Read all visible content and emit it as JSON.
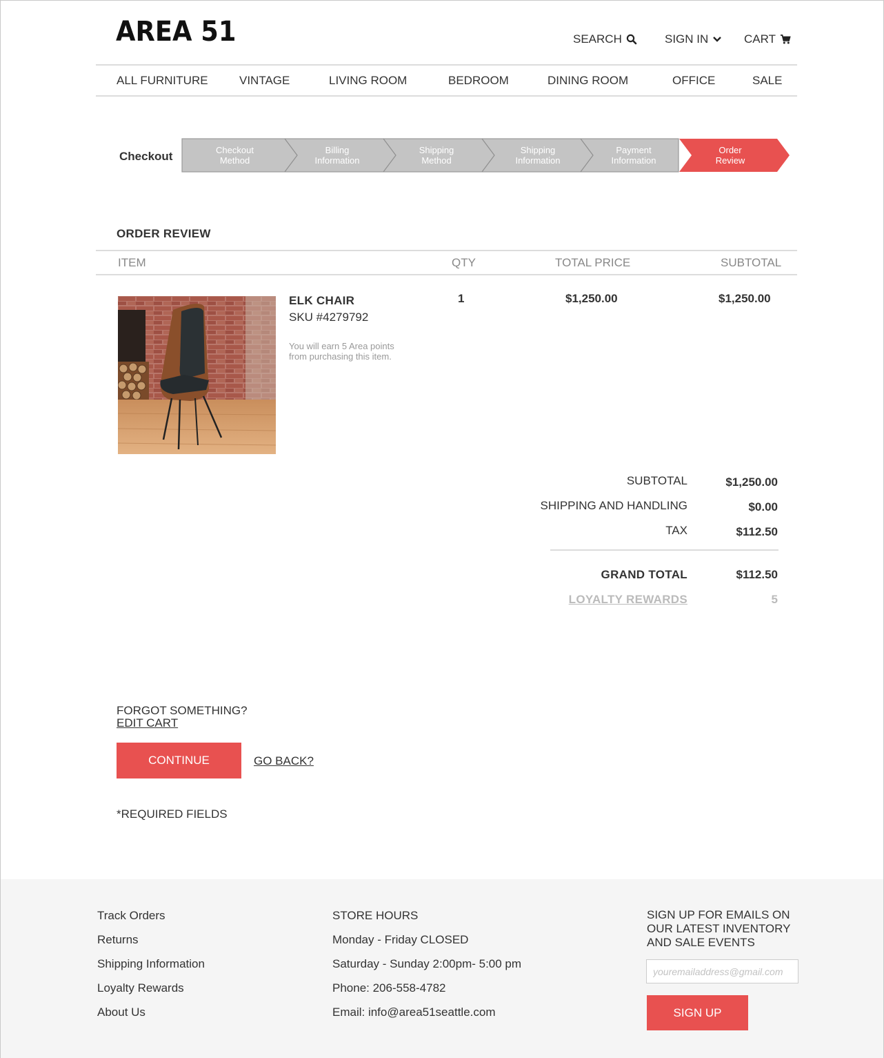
{
  "header": {
    "logo": "AREA 51",
    "search_label": "SEARCH",
    "signin_label": "SIGN IN",
    "cart_label": "CART"
  },
  "nav": [
    "ALL FURNITURE",
    "VINTAGE",
    "LIVING ROOM",
    "BEDROOM",
    "DINING ROOM",
    "OFFICE",
    "SALE"
  ],
  "checkout": {
    "label": "Checkout",
    "steps": [
      {
        "line1": "Checkout",
        "line2": "Method",
        "active": false
      },
      {
        "line1": "Billing",
        "line2": "Information",
        "active": false
      },
      {
        "line1": "Shipping",
        "line2": "Method",
        "active": false
      },
      {
        "line1": "Shipping",
        "line2": "Information",
        "active": false
      },
      {
        "line1": "Payment",
        "line2": "Information",
        "active": false
      },
      {
        "line1": "Order",
        "line2": "Review",
        "active": true
      }
    ],
    "inactive_color": "#c4c4c4",
    "active_color": "#e85150"
  },
  "order_review": {
    "title": "ORDER REVIEW",
    "columns": {
      "item": "ITEM",
      "qty": "QTY",
      "total_price": "TOTAL PRICE",
      "subtotal": "SUBTOTAL"
    },
    "item": {
      "name": "ELK CHAIR",
      "sku": "SKU #4279792",
      "note": "You will earn 5 Area points from purchasing this item.",
      "qty": "1",
      "total_price": "$1,250.00",
      "subtotal": "$1,250.00"
    },
    "summary": {
      "subtotal_label": "SUBTOTAL",
      "subtotal_value": "$1,250.00",
      "shipping_label": "SHIPPING AND HANDLING",
      "shipping_value": "$0.00",
      "tax_label": "TAX",
      "tax_value": "$112.50",
      "grand_total_label": "GRAND TOTAL",
      "grand_total_value": "$112.50",
      "loyalty_label": "LOYALTY REWARDS",
      "loyalty_value": "5"
    }
  },
  "actions": {
    "forgot": "FORGOT SOMETHING?",
    "edit_cart": "EDIT CART",
    "continue": "CONTINUE",
    "go_back": "GO BACK?",
    "required": "*REQUIRED FIELDS"
  },
  "footer": {
    "links": [
      "Track Orders",
      "Returns",
      "Shipping Information",
      "Loyalty Rewards",
      "About Us"
    ],
    "store_hours_title": "STORE HOURS",
    "store_hours": [
      "Monday - Friday CLOSED",
      "Saturday - Sunday 2:00pm- 5:00 pm",
      "Phone: 206-558-4782",
      "Email: info@area51seattle.com"
    ],
    "signup_text": [
      "SIGN UP FOR EMAILS ON",
      "OUR LATEST INVENTORY",
      "AND SALE EVENTS"
    ],
    "email_placeholder": "youremailaddress@gmail.com",
    "signup_button": "SIGN UP"
  },
  "colors": {
    "accent": "#e85150",
    "footer_bg": "#f5f5f5"
  }
}
